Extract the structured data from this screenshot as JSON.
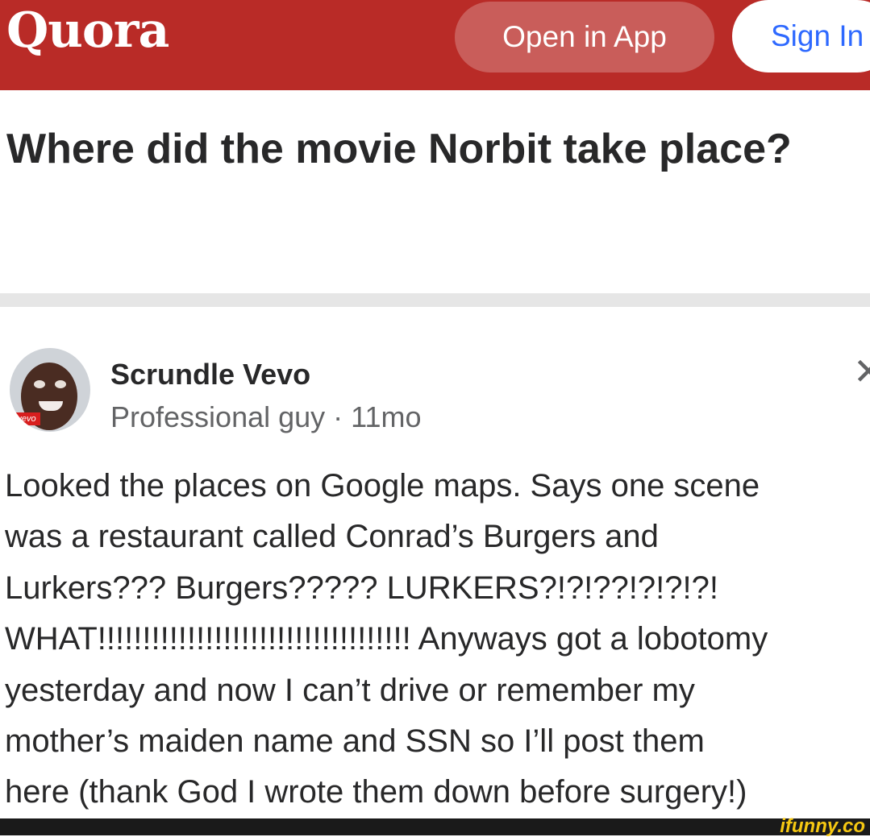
{
  "header": {
    "logo": "Quora",
    "open_in_app": "Open in App",
    "sign_in": "Sign In"
  },
  "question": {
    "title": "Where did the movie Norbit take place?"
  },
  "answer": {
    "author_name": "Scrundle Vevo",
    "author_meta": "Professional guy · 11mo",
    "avatar_tag": "vevo",
    "lines": [
      "Looked the places on Google maps. Says one scene",
      "was a restaurant called Conrad’s Burgers and",
      "Lurkers??? Burgers????? LURKERS?!?!??!?!?!?!",
      "WHAT!!!!!!!!!!!!!!!!!!!!!!!!!!!!!!!!!!! Anyways got a lobotomy",
      "yesterday and now I can’t drive or remember my",
      "mother’s maiden name and SSN so I’ll post them",
      "here (thank God I wrote them down before surgery!)"
    ]
  },
  "watermark": "ifunny.co",
  "colors": {
    "brand_red": "#b92b27",
    "sign_in_blue": "#2e69ff",
    "text": "#282829",
    "meta": "#636466"
  },
  "icons": {
    "close": "close-icon"
  }
}
